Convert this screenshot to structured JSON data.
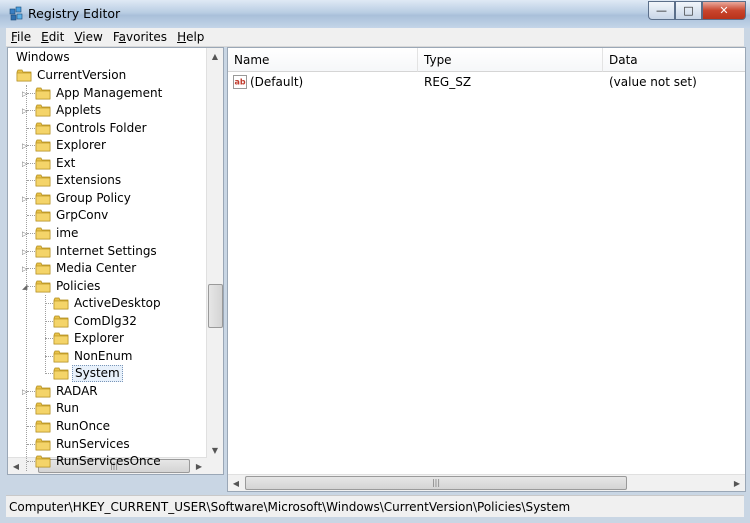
{
  "window": {
    "title": "Registry Editor"
  },
  "menu": [
    "File",
    "Edit",
    "View",
    "Favorites",
    "Help"
  ],
  "menu_underline": [
    "F",
    "E",
    "V",
    "a",
    "H"
  ],
  "tree": {
    "root_label": "Windows",
    "items": [
      {
        "label": "CurrentVersion",
        "level": 0,
        "expander": "none"
      },
      {
        "label": "App Management",
        "level": 1,
        "expander": "collapsed"
      },
      {
        "label": "Applets",
        "level": 1,
        "expander": "collapsed"
      },
      {
        "label": "Controls Folder",
        "level": 1,
        "expander": "none"
      },
      {
        "label": "Explorer",
        "level": 1,
        "expander": "collapsed"
      },
      {
        "label": "Ext",
        "level": 1,
        "expander": "collapsed"
      },
      {
        "label": "Extensions",
        "level": 1,
        "expander": "none"
      },
      {
        "label": "Group Policy",
        "level": 1,
        "expander": "collapsed"
      },
      {
        "label": "GrpConv",
        "level": 1,
        "expander": "none"
      },
      {
        "label": "ime",
        "level": 1,
        "expander": "collapsed"
      },
      {
        "label": "Internet Settings",
        "level": 1,
        "expander": "collapsed"
      },
      {
        "label": "Media Center",
        "level": 1,
        "expander": "collapsed"
      },
      {
        "label": "Policies",
        "level": 1,
        "expander": "expanded"
      },
      {
        "label": "ActiveDesktop",
        "level": 2,
        "expander": "none"
      },
      {
        "label": "ComDlg32",
        "level": 2,
        "expander": "none"
      },
      {
        "label": "Explorer",
        "level": 2,
        "expander": "none"
      },
      {
        "label": "NonEnum",
        "level": 2,
        "expander": "none"
      },
      {
        "label": "System",
        "level": 2,
        "expander": "none",
        "selected": true
      },
      {
        "label": "RADAR",
        "level": 1,
        "expander": "collapsed"
      },
      {
        "label": "Run",
        "level": 1,
        "expander": "none"
      },
      {
        "label": "RunOnce",
        "level": 1,
        "expander": "none"
      },
      {
        "label": "RunServices",
        "level": 1,
        "expander": "none"
      },
      {
        "label": "RunServicesOnce",
        "level": 1,
        "expander": "none"
      }
    ]
  },
  "values": {
    "columns": [
      "Name",
      "Type",
      "Data"
    ],
    "rows": [
      {
        "name": "(Default)",
        "type": "REG_SZ",
        "data": "(value not set)",
        "icon": "string-value-icon"
      }
    ]
  },
  "status": {
    "path": "Computer\\HKEY_CURRENT_USER\\Software\\Microsoft\\Windows\\CurrentVersion\\Policies\\System"
  },
  "colors": {
    "folder": "#e8c24a",
    "selection": "#e8f1fb",
    "close_button": "#c9452d"
  }
}
